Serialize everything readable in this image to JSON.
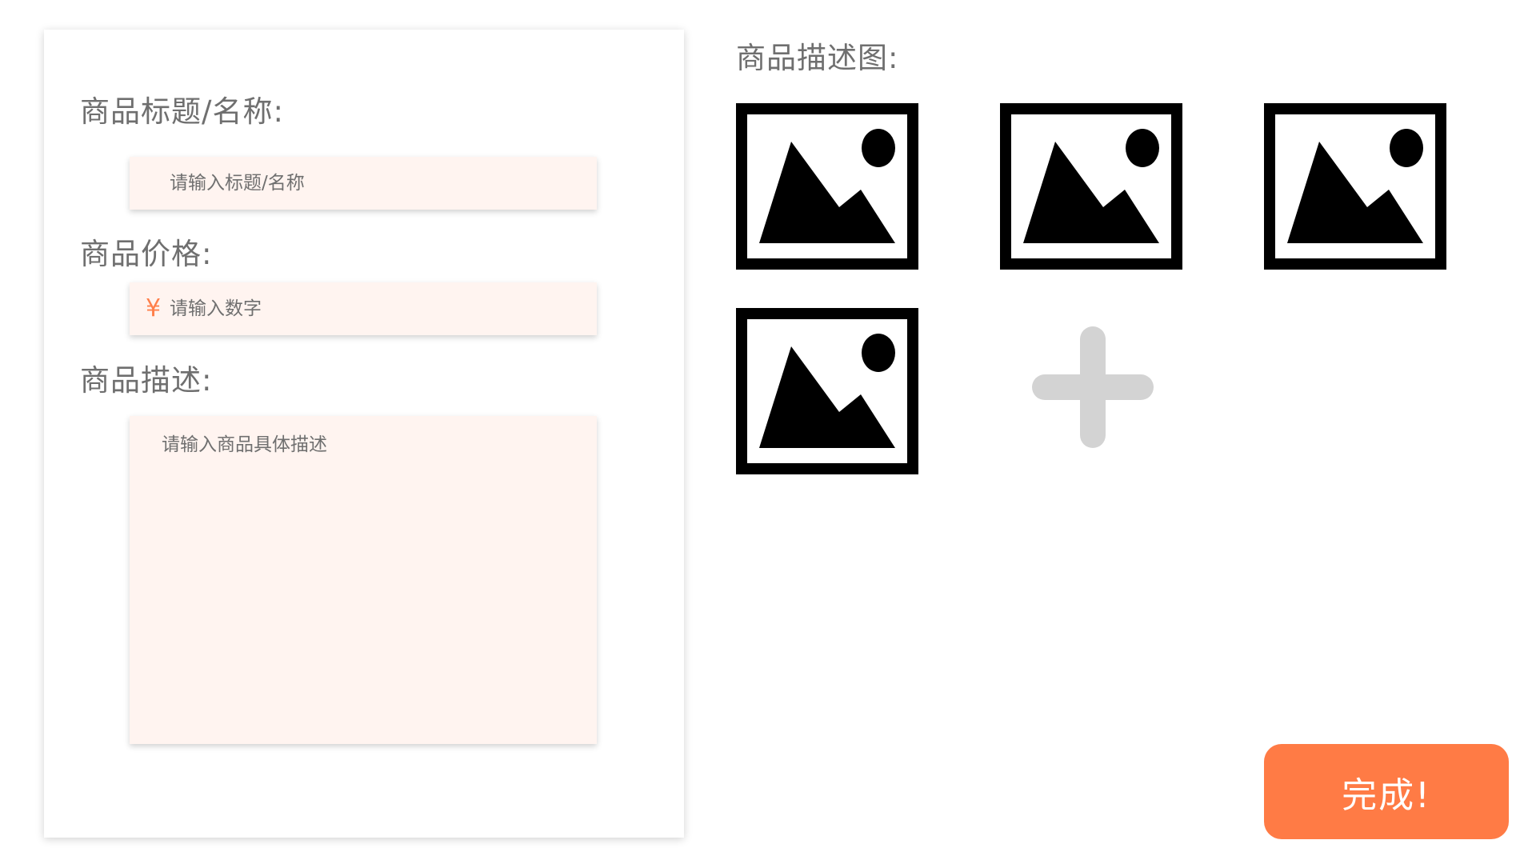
{
  "form": {
    "title_label": "商品标题/名称:",
    "title_placeholder": "请输入标题/名称",
    "price_label": "商品价格:",
    "price_currency": "¥",
    "price_placeholder": "请输入数字",
    "desc_label": "商品描述:",
    "desc_placeholder": "请输入商品具体描述"
  },
  "images": {
    "label": "商品描述图:",
    "thumbnail_icon": "image-icon",
    "thumbnail_count": 4,
    "add_icon": "plus-icon"
  },
  "actions": {
    "done_label": "完成!"
  },
  "colors": {
    "accent": "#ff7b45",
    "field_bg": "#fff4f0",
    "add_icon": "#d3d3d3"
  }
}
